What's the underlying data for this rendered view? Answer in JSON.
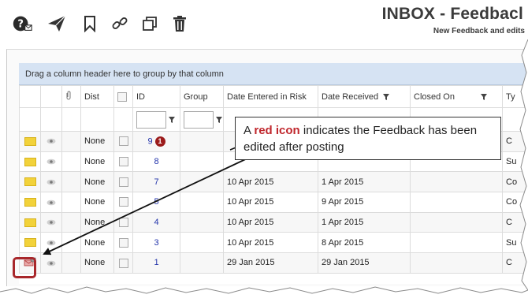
{
  "toolbar": {
    "icons": [
      "help-icon",
      "send-icon",
      "bookmark-icon",
      "link-icon",
      "copy-icon",
      "trash-icon"
    ]
  },
  "header": {
    "title": "INBOX - Feedbacl",
    "subtitle": "New Feedback and edits"
  },
  "grid": {
    "group_panel_text": "Drag a column header here to group by that column",
    "columns": {
      "dist": "Dist",
      "id": "ID",
      "group": "Group",
      "date_entered": "Date Entered in Risk",
      "date_received": "Date Received",
      "closed_on": "Closed On",
      "type": "Ty"
    },
    "rows": [
      {
        "dist": "None",
        "id": "9",
        "date_entered": "",
        "date_received": "",
        "type": "C"
      },
      {
        "dist": "None",
        "id": "8",
        "date_entered": "",
        "date_received": "",
        "type": "Su"
      },
      {
        "dist": "None",
        "id": "7",
        "date_entered": "10 Apr 2015",
        "date_received": "1 Apr 2015",
        "type": "Co"
      },
      {
        "dist": "None",
        "id": "5",
        "date_entered": "10 Apr 2015",
        "date_received": "9 Apr 2015",
        "type": "Co"
      },
      {
        "dist": "None",
        "id": "4",
        "date_entered": "10 Apr 2015",
        "date_received": "1 Apr 2015",
        "type": "C"
      },
      {
        "dist": "None",
        "id": "3",
        "date_entered": "10 Apr 2015",
        "date_received": "8 Apr 2015",
        "type": "Su"
      },
      {
        "dist": "None",
        "id": "1",
        "date_entered": "29 Jan 2015",
        "date_received": "29 Jan 2015",
        "type": "C"
      }
    ],
    "badge_number": "1"
  },
  "callout": {
    "prefix": "A ",
    "highlight": "red icon",
    "suffix": " indicates the Feedback has been edited after posting"
  },
  "colors": {
    "accent_red": "#a8272b",
    "group_panel": "#d6e3f3",
    "link_blue": "#2233aa",
    "envelope": "#f2d23a"
  }
}
